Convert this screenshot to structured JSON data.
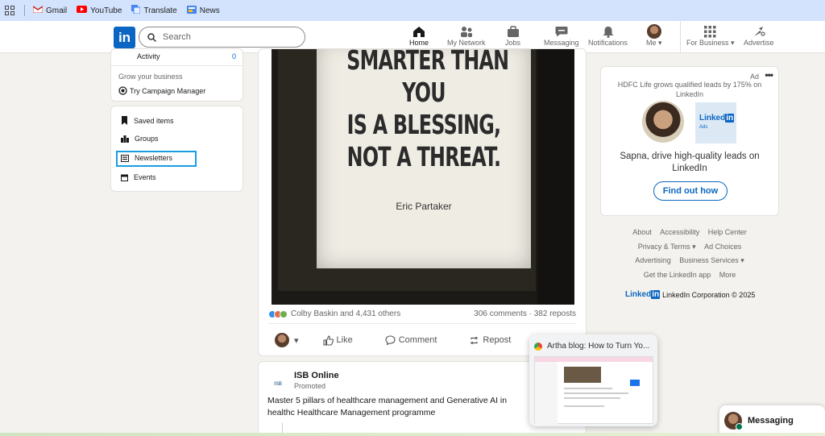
{
  "bookmarks": {
    "items": [
      "Gmail",
      "YouTube",
      "Translate",
      "News"
    ]
  },
  "nav": {
    "search_placeholder": "Search",
    "items": [
      {
        "label": "Home",
        "icon": "home-icon"
      },
      {
        "label": "My Network",
        "icon": "network-icon"
      },
      {
        "label": "Jobs",
        "icon": "briefcase-icon"
      },
      {
        "label": "Messaging",
        "icon": "chat-icon"
      },
      {
        "label": "Notifications",
        "icon": "bell-icon"
      },
      {
        "label": "Me",
        "icon": "avatar"
      },
      {
        "label": "For Business",
        "icon": "grid-icon"
      },
      {
        "label": "Advertise",
        "icon": "compass-icon"
      }
    ]
  },
  "left": {
    "activity_label": "Activity",
    "activity_count": "0",
    "grow_text": "Grow your business",
    "campaign_label": "Try Campaign Manager",
    "menu": [
      "Saved items",
      "Groups",
      "Newsletters",
      "Events"
    ]
  },
  "post": {
    "quote": "SMARTER THAN\nYOU\nIS A BLESSING,\nNOT A THREAT.",
    "author": "Eric Partaker",
    "reactions_text": "Colby Baskin and 4,431 others",
    "counts_text": "306 comments · 382 reposts",
    "actions": {
      "like": "Like",
      "comment": "Comment",
      "repost": "Repost"
    }
  },
  "promo": {
    "logo_text": "ISB",
    "name": "ISB Online",
    "promoted": "Promoted",
    "text": "Master 5 pillars of healthcare management and Generative AI in healthc Healthcare Management programme"
  },
  "ad": {
    "label": "Ad",
    "headline": "HDFC Life grows qualified leads by 175% on LinkedIn",
    "logo_word": "Linked",
    "logo_in": "in",
    "logo_sub": "Ads",
    "cta_text": "Sapna, drive high-quality leads on LinkedIn",
    "button": "Find out how"
  },
  "footer": {
    "rows": [
      [
        "About",
        "Accessibility",
        "Help Center"
      ],
      [
        "Privacy & Terms ▾",
        "Ad Choices"
      ],
      [
        "Advertising",
        "Business Services ▾"
      ],
      [
        "Get the LinkedIn app",
        "More"
      ]
    ],
    "corp_brand": "Linked",
    "corp_brand_in": "in",
    "corp_text": "LinkedIn Corporation © 2025"
  },
  "tab_preview": {
    "title": "Artha blog: How to Turn Yo..."
  },
  "messaging": {
    "label": "Messaging"
  }
}
